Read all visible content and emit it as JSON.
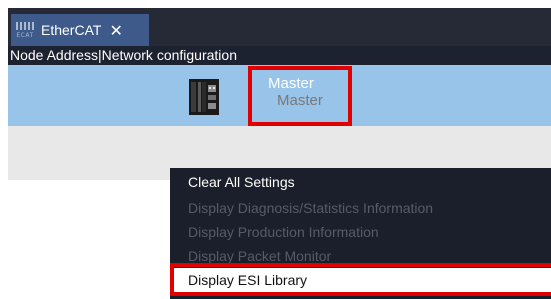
{
  "tab": {
    "label": "EtherCAT",
    "icon_caption": "ECAT",
    "icon_name": "ethercat-icon",
    "close_glyph": "✕"
  },
  "header": {
    "text": "Node Address|Network configuration"
  },
  "master": {
    "name": "Master",
    "type": "Master",
    "icon_name": "master-device-icon"
  },
  "context_menu": {
    "items": [
      {
        "label": "Clear All Settings",
        "enabled": true
      },
      {
        "label": "Display Diagnosis/Statistics Information",
        "enabled": false
      },
      {
        "label": "Display Production Information",
        "enabled": false
      },
      {
        "label": "Display Packet Monitor",
        "enabled": false
      },
      {
        "label": "Display ESI Library",
        "enabled": true,
        "selected": true
      }
    ]
  },
  "colors": {
    "highlight_box": "#e00000",
    "tab_bg": "#3d5a8a",
    "selected_row": "#99c4ea",
    "menu_bg": "#1b1f2b"
  }
}
